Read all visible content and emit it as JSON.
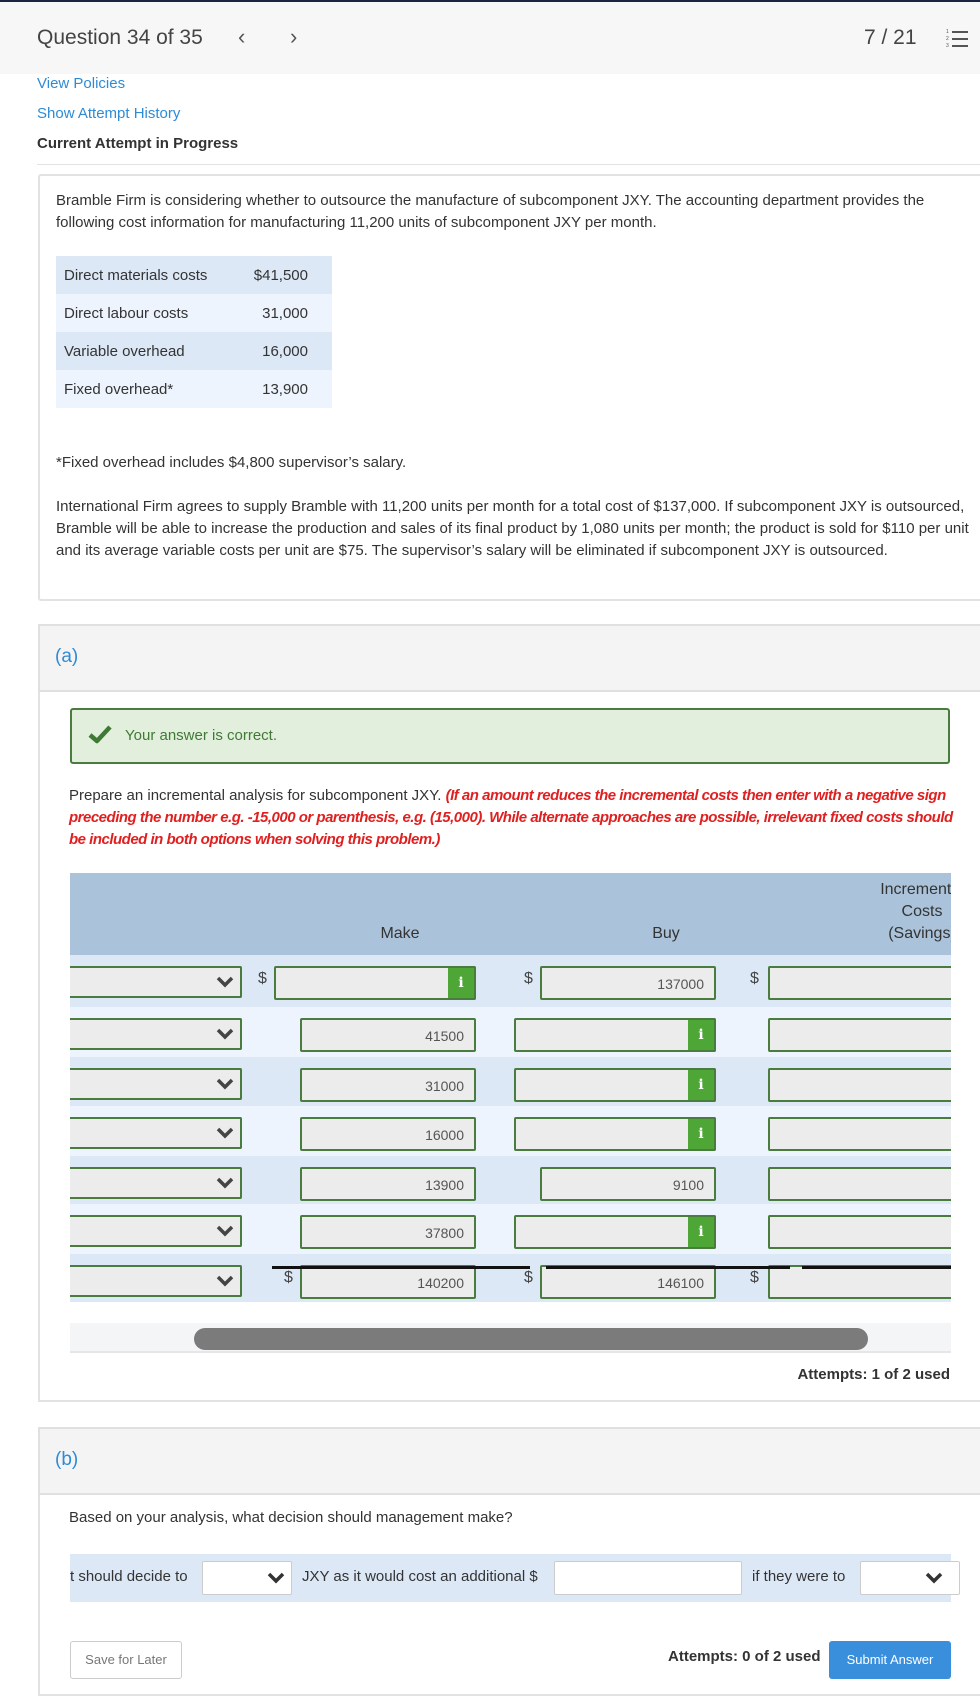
{
  "header": {
    "question_title": "Question 34 of 35",
    "prev_icon": "chevron-left-icon",
    "prev_glyph": "‹",
    "next_icon": "chevron-right-icon",
    "next_glyph": "›",
    "progress": "7 / 21",
    "list_icon": "numbered-list-icon"
  },
  "links": {
    "view_policies": "View Policies",
    "show_attempt_history": "Show Attempt History"
  },
  "status": "Current Attempt in Progress",
  "problem": {
    "intro": "Bramble Firm is considering whether to outsource the manufacture of subcomponent JXY. The accounting department provides the following cost information for manufacturing 11,200 units of subcomponent JXY per month.",
    "costs": [
      {
        "label": "Direct materials costs",
        "value": "$41,500"
      },
      {
        "label": "Direct labour costs",
        "value": "31,000"
      },
      {
        "label": "Variable overhead",
        "value": "16,000"
      },
      {
        "label": "Fixed overhead*",
        "value": "13,900"
      }
    ],
    "footnote": "*Fixed overhead includes $4,800 supervisor’s salary.",
    "details": "International Firm agrees to supply Bramble with 11,200 units per month for a total cost of $137,000. If subcomponent JXY is outsourced, Bramble will be able to increase the production and sales of its final product by 1,080 units per month; the product is sold for $110 per unit and its average variable costs per unit are $75. The supervisor’s salary will be eliminated if subcomponent JXY is outsourced."
  },
  "part_a": {
    "label": "(a)",
    "feedback": "Your answer is correct.",
    "feedback_icon": "checkmark-icon",
    "instruction": "Prepare an incremental analysis for subcomponent JXY.",
    "instruction_note": "(If an amount reduces the incremental costs then enter with a negative sign preceding the number e.g. -15,000 or parenthesis, e.g. (15,000). While alternate approaches are possible, irrelevant fixed costs should be included in both options when solving this problem.)",
    "columns": {
      "make": "Make",
      "buy": "Buy",
      "incremental_line1": "Incremental",
      "incremental_line2": "Costs",
      "incremental_line3": "(Savings)"
    },
    "currency_symbol": "$",
    "info_glyph": "i",
    "rows": [
      {
        "item": "",
        "make": "",
        "buy": "137000",
        "incremental": ""
      },
      {
        "item": "",
        "make": "41500",
        "buy": "",
        "incremental": ""
      },
      {
        "item": "",
        "make": "31000",
        "buy": "",
        "incremental": ""
      },
      {
        "item": "",
        "make": "16000",
        "buy": "",
        "incremental": ""
      },
      {
        "item": "",
        "make": "13900",
        "buy": "9100",
        "incremental": ""
      },
      {
        "item": "",
        "make": "37800",
        "buy": "",
        "incremental": ""
      },
      {
        "item": "",
        "make": "140200",
        "buy": "146100",
        "incremental": ""
      }
    ],
    "attempts": "Attempts: 1 of 2 used"
  },
  "part_b": {
    "label": "(b)",
    "question": "Based on your analysis, what decision should management make?",
    "text_1": "t should decide to",
    "select_1_value": "",
    "text_2": "JXY as it would cost an additional $",
    "amount_value": "",
    "text_3": "if they were to",
    "select_2_value": "",
    "save_label": "Save for Later",
    "attempts": "Attempts: 0 of 2 used",
    "submit_label": "Submit Answer"
  }
}
